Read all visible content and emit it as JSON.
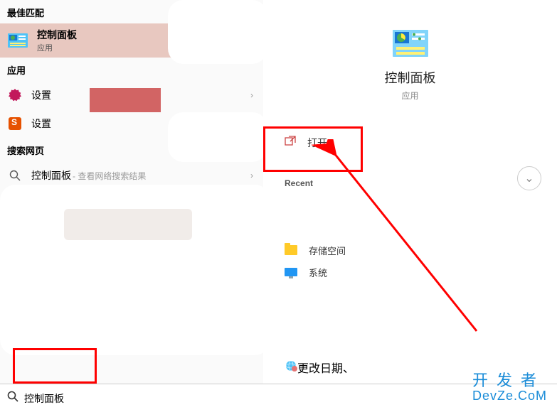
{
  "sections": {
    "best_match": "最佳匹配",
    "apps": "应用",
    "web": "搜索网页"
  },
  "best": {
    "title": "控制面板",
    "sub": "应用"
  },
  "apps": [
    {
      "label": "设置",
      "icon": "gear-magenta"
    },
    {
      "label": "设置",
      "icon": "gear-orange"
    }
  ],
  "web": {
    "label": "控制面板",
    "hint": " - 查看网络搜索结果"
  },
  "search": {
    "value": "控制面板"
  },
  "detail": {
    "title": "控制面板",
    "sub": "应用",
    "open": "打开",
    "recent_header": "Recent"
  },
  "recent": [
    {
      "label": "存储空间",
      "icon": "folder"
    },
    {
      "label": "系统",
      "icon": "monitor"
    }
  ],
  "more": {
    "label": "更改日期、"
  },
  "brand": {
    "cn": "开发者",
    "en": "DevZe.CoM"
  }
}
